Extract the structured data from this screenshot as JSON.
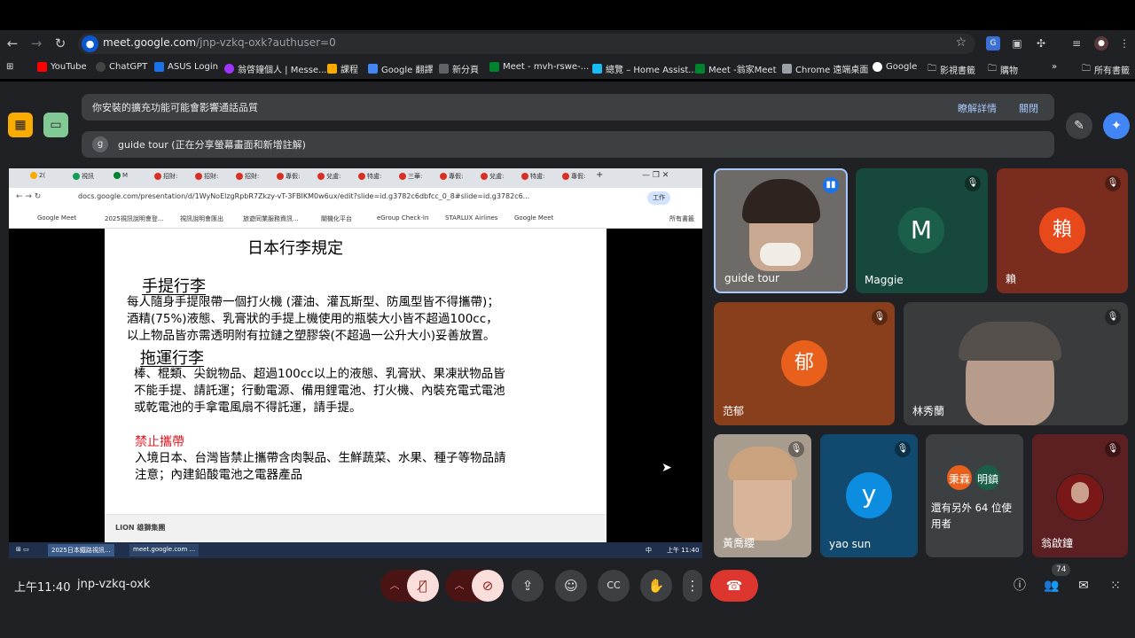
{
  "browser": {
    "url_host": "meet.google.com",
    "url_path": "/jnp-vzkq-oxk?authuser=0",
    "bookmarks": [
      "YouTube",
      "ChatGPT",
      "ASUS Login",
      "翁啓鐘個人 | Messe...",
      "課程",
      "Google 翻譯",
      "新分頁",
      "Meet - mvh-rswe-...",
      "總覽 – Home Assist...",
      "Meet -翁家Meet",
      "Chrome 遠端桌面",
      "Google",
      "影視書籤",
      "購物"
    ],
    "all_bookmarks": "所有書籤"
  },
  "banners": {
    "ext_warning": "你安裝的擴充功能可能會影響通話品質",
    "learn_more": "瞭解詳情",
    "close": "關閉",
    "presenter_badge": "g",
    "presenter_text": "guide tour (正在分享螢幕畫面和新增註解)"
  },
  "presentation": {
    "tabs": [
      "2(",
      "視訊",
      "M",
      "招財:",
      "招財:",
      "招財:",
      "專假:",
      "兌盧:",
      "特盧:",
      "三華:",
      "專假:",
      "兌盧:",
      "特盧:",
      "專假:"
    ],
    "url": "docs.google.com/presentation/d/1WyNoElzgRpbR7Zkzy-vT-3FBIKM0w6ux/edit?slide=id.g3782c6dbfcc_0_8#slide=id.g3782c6...",
    "work_badge": "工作",
    "bookmarks": [
      "Google Meet",
      "2025視訊說明會登...",
      "視訊說明會匯出",
      "旅遊同業服務資訊...",
      "關機化平台",
      "eGroup Check-In",
      "STARLUX Airlines",
      "Google Meet"
    ],
    "all_bookmarks": "所有書籤",
    "slide": {
      "title": "日本行李規定",
      "h1": "手提行李",
      "body1": "每人隨身手提限帶一個打火機 (灌油、灌瓦斯型、防風型皆不得攜帶)；\n酒精(75%)液態、乳膏狀的手提上機使用的瓶裝大小皆不超過100cc，\n以上物品皆亦需透明附有拉鏈之塑膠袋(不超過一公升大小)妥善放置。",
      "h2": "拖運行李",
      "body2": "棒、棍類、尖銳物品、超過100cc以上的液態、乳膏狀、果凍狀物品皆\n不能手提、請託運；行動電源、備用鋰電池、打火機、內裝充電式電池\n或乾電池的手拿電風扇不得託運，請手提。",
      "h3": "禁止攜帶",
      "body3": "入境日本、台灣皆禁止攜帶含肉製品、生鮮蔬菜、水果、種子等物品請\n注意；內建鉛酸電池之電器產品",
      "footer_logo": "LION 雄獅集團"
    },
    "taskbar": {
      "task1": "2025日本鐵路視訊...",
      "task2": "meet.google.com ...",
      "ime": "中",
      "time": "上午 11:40"
    }
  },
  "participants": [
    {
      "name": "guide tour",
      "initial": ""
    },
    {
      "name": "Maggie",
      "initial": "M"
    },
    {
      "name": "賴",
      "initial": "賴"
    },
    {
      "name": "范郁",
      "initial": "郁"
    },
    {
      "name": "林秀蘭",
      "initial": ""
    },
    {
      "name": "黃喬纓",
      "initial": ""
    },
    {
      "name": "yao sun",
      "initial": "y"
    },
    {
      "name": "還有另外 64 位使用者",
      "initial": "",
      "avatars": [
        "秉霖",
        "明鎮"
      ]
    },
    {
      "name": "翁啟鐘",
      "initial": ""
    }
  ],
  "bottom": {
    "time": "上午11:40",
    "meeting_code": "jnp-vzkq-oxk",
    "people_count": "74"
  },
  "colors": {
    "meet_bg": "#202124",
    "end_call": "#dc362e",
    "muted_ctrl": "#f9dedc",
    "accent_blue": "#a8c7fa"
  }
}
